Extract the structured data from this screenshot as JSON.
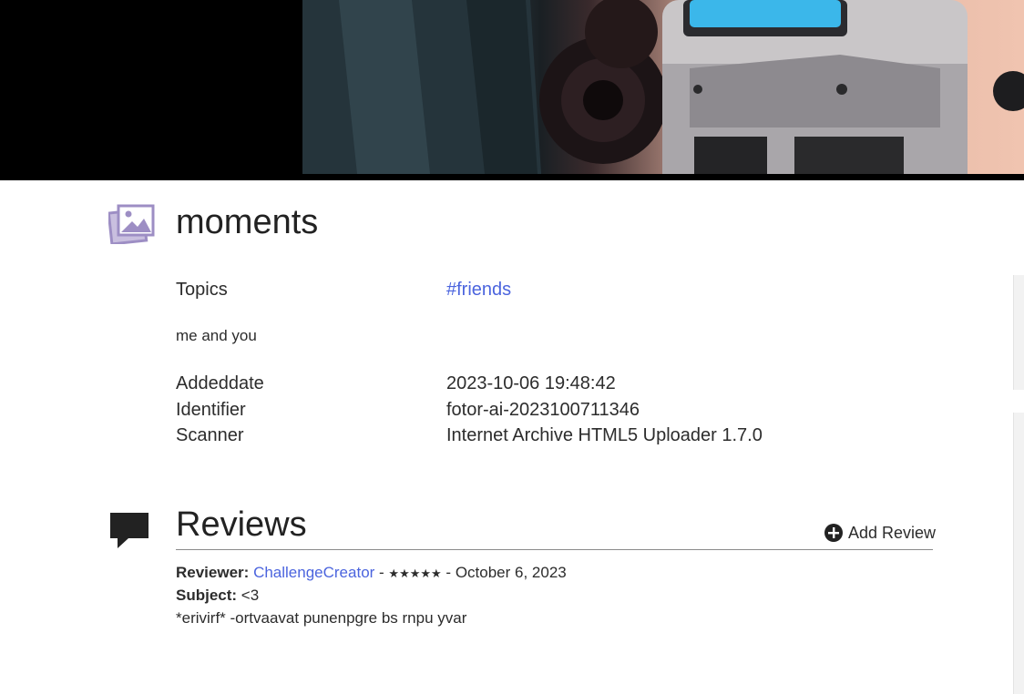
{
  "item": {
    "title": "moments",
    "title_icon": "image-gallery-icon"
  },
  "metadata": {
    "topics_label": "Topics",
    "topics_value": "#friends",
    "description": "me and you",
    "rows": [
      {
        "label": "Addeddate",
        "value": "2023-10-06 19:48:42"
      },
      {
        "label": "Identifier",
        "value": "fotor-ai-2023100711346"
      },
      {
        "label": "Scanner",
        "value": "Internet Archive HTML5 Uploader 1.7.0"
      }
    ]
  },
  "reviews": {
    "heading": "Reviews",
    "icon": "speech-bubble-icon",
    "add_review_label": "Add Review",
    "items": [
      {
        "reviewer_label": "Reviewer:",
        "reviewer": "ChallengeCreator",
        "separator1": " - ",
        "stars": "★★★★★",
        "separator2": " - ",
        "date": "October 6, 2023",
        "subject_label": "Subject:",
        "subject": "<3",
        "body": "*erivirf* -ortvaavat punenpgre bs rnpu yvar"
      }
    ]
  },
  "colors": {
    "link": "#4b64de",
    "icon_purple": "#9d8ec4",
    "text": "#2c2c2c"
  }
}
